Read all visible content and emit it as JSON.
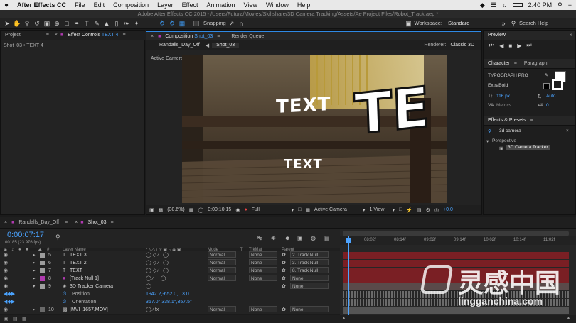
{
  "menubar": {
    "apple": "",
    "app_name": "After Effects CC",
    "items": [
      "File",
      "Edit",
      "Composition",
      "Layer",
      "Effect",
      "Animation",
      "View",
      "Window",
      "Help"
    ],
    "time": "2:40 PM"
  },
  "titlebar": {
    "text": "Adobe After Effects CC 2015 - /Users/Futura/Movies/Skillshare/3D Camera Tracking/Assets/Ae Project Files/Robot_Track.aep *"
  },
  "toolbar": {
    "snapping_label": "Snapping",
    "workspace_label": "Workspace:",
    "workspace_value": "Standard",
    "search_placeholder": "Search Help"
  },
  "left_panel": {
    "tab_project": "Project",
    "tab_effect_controls": "Effect Controls",
    "tab_effect_controls_layer": "TEXT 4",
    "breadcrumb": "Shot_03 • TEXT 4"
  },
  "comp_panel": {
    "tab_label": "Composition",
    "tab_comp_name": "Shot_03",
    "tab_render_queue": "Render Queue",
    "sub_tabs": [
      "Randalls_Day_Off",
      "Shot_03"
    ],
    "renderer_label": "Renderer:",
    "renderer_value": "Classic 3D",
    "active_camera_label": "Active Camera",
    "overlay_text_1": "TEXT",
    "overlay_text_2": "TEXT",
    "overlay_text_big": "TE",
    "footer": {
      "zoom": "(30.6%)",
      "timecode": "0:00:10:15",
      "resolution": "Full",
      "view": "Active Camera",
      "views": "1 View",
      "exposure": "+0.0"
    }
  },
  "right_panel": {
    "preview_tab": "Preview",
    "character_tab": "Character",
    "paragraph_tab": "Paragraph",
    "font_name": "TYPOGRAPH PRO",
    "font_style": "ExtraBold",
    "font_size": "116 px",
    "leading": "Auto",
    "kerning_label": "Metrics",
    "tracking": "0",
    "effects_tab": "Effects & Presets",
    "effects_search": "3d camera",
    "effects_category": "Perspective",
    "effects_item": "3D Camera Tracker"
  },
  "timeline": {
    "tabs": [
      "Randalls_Day_Off",
      "Shot_03"
    ],
    "timecode": "0:00:07:17",
    "fps_label": "00185 (23.976 fps)",
    "columns": {
      "layer_name": "Layer Name",
      "mode": "Mode",
      "t": "T",
      "trkmat": "TrkMat",
      "parent": "Parent"
    },
    "ruler_labels": [
      "08:02f",
      "08:14f",
      "09:02f",
      "09:14f",
      "10:02f",
      "10:14f",
      "11:02f"
    ],
    "layers": [
      {
        "num": "5",
        "name": "TEXT 3",
        "mode": "Normal",
        "trkmat": "None",
        "parent": "2. Track Null",
        "color": "#9e9e9e"
      },
      {
        "num": "6",
        "name": "TEXT 2",
        "mode": "Normal",
        "trkmat": "None",
        "parent": "3. Track Null",
        "color": "#9e9e9e"
      },
      {
        "num": "7",
        "name": "TEXT",
        "mode": "Normal",
        "trkmat": "None",
        "parent": "8. Track Null",
        "color": "#9e9e9e"
      },
      {
        "num": "8",
        "name": "[Track Null 1]",
        "mode": "Normal",
        "trkmat": "None",
        "parent": "None",
        "color": "#b03ab0"
      },
      {
        "num": "9",
        "name": "3D Tracker Camera",
        "mode": "",
        "trkmat": "",
        "parent": "None",
        "color": "#9e9e9e"
      },
      {
        "num": "10",
        "name": "[MVI_1657.MOV]",
        "mode": "Normal",
        "trkmat": "None",
        "parent": "None",
        "color": "#6a6a6a"
      }
    ],
    "position_label": "Position",
    "position_value": "1942.2,-652.0,...3.0",
    "orientation_label": "Orientation",
    "orientation_value": "357.0°,338.1°,357.5°"
  },
  "watermark": {
    "cn_text": "灵感中国",
    "url": "lingganchina.com"
  },
  "colors": {
    "accent_blue": "#2f8ae6",
    "timeline_red": "#7a1f24",
    "timeline_gray": "#555555",
    "playhead": "#4da3ff"
  }
}
